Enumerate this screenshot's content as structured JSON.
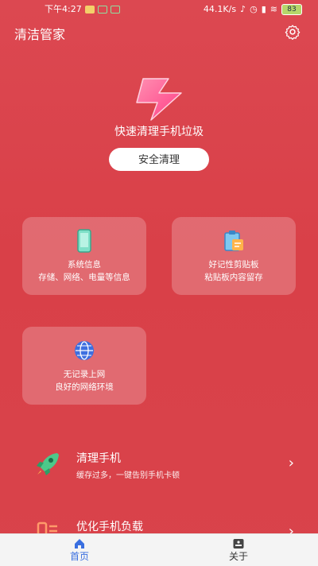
{
  "status_bar": {
    "time": "下午4:27",
    "net_speed": "44.1K/s",
    "battery": "83"
  },
  "header": {
    "title": "清洁管家",
    "settings_icon": "gear-icon"
  },
  "hero": {
    "logo_icon": "bolt-logo-icon",
    "slogan": "快速清理手机垃圾",
    "clean_button": "安全清理"
  },
  "cards": [
    {
      "icon": "phone-icon",
      "line1": "系统信息",
      "line2": "存储、网络、电量等信息"
    },
    {
      "icon": "clipboard-icon",
      "line1": "好记性剪贴板",
      "line2": "粘贴板内容留存"
    },
    {
      "icon": "globe-icon",
      "line1": "无记录上网",
      "line2": "良好的网络环境"
    }
  ],
  "list": [
    {
      "icon": "rocket-icon",
      "title": "清理手机",
      "subtitle": "缓存过多，一键告别手机卡顿"
    },
    {
      "icon": "memory-icon",
      "title": "优化手机负载",
      "subtitle": ""
    }
  ],
  "bottom_nav": {
    "tabs": [
      {
        "label": "首页",
        "icon": "home-icon",
        "active": true
      },
      {
        "label": "关于",
        "icon": "about-icon",
        "active": false
      }
    ]
  },
  "colors": {
    "background": "#d9434b",
    "accent": "#3a6fe0",
    "card": "rgba(255,255,255,0.22)"
  }
}
